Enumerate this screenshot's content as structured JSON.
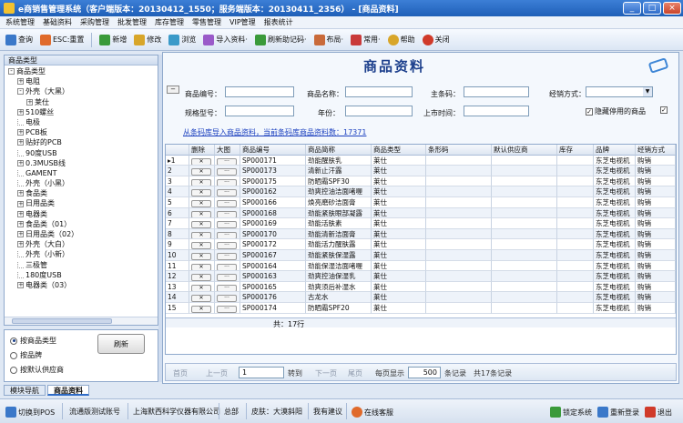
{
  "window": {
    "title": "e商销售管理系统（客户端版本：20130412_1550；服务端版本：20130411_2356） - [商品资料]",
    "minimize": "_",
    "maximize": "□",
    "close": "×"
  },
  "menu": [
    "系统管理",
    "基础资料",
    "采购管理",
    "批发管理",
    "库存管理",
    "零售管理",
    "VIP管理",
    "报表统计"
  ],
  "toolbar": [
    {
      "label": "查询",
      "icon": "search-icon",
      "color": "#3a78c9"
    },
    {
      "label": "ESC:重置",
      "icon": "reset-icon",
      "color": "#e06a2b"
    },
    {
      "label": "新增",
      "icon": "add-icon",
      "color": "#3a9a3a"
    },
    {
      "label": "修改",
      "icon": "edit-icon",
      "color": "#d8a62a"
    },
    {
      "label": "浏览",
      "icon": "browse-icon",
      "color": "#3a9ac9"
    },
    {
      "label": "导入资料·",
      "icon": "import-icon",
      "color": "#9a5ac9"
    },
    {
      "label": "刷新助记码·",
      "icon": "refresh-code-icon",
      "color": "#3a9a3a"
    },
    {
      "label": "布局·",
      "icon": "layout-icon",
      "color": "#c96a3a"
    },
    {
      "label": "常用·",
      "icon": "favorite-icon",
      "color": "#c93a3a"
    },
    {
      "label": "帮助",
      "icon": "help-icon",
      "color": "#d8a62a"
    },
    {
      "label": "关闭",
      "icon": "close-icon",
      "color": "#d03a2a"
    }
  ],
  "left_panel": {
    "header": "商品类型",
    "tree": [
      {
        "label": "商品类型",
        "level": 0,
        "expander": "-"
      },
      {
        "label": "电阻",
        "level": 1,
        "expander": "+"
      },
      {
        "label": "外壳（大黑）",
        "level": 1,
        "expander": "-"
      },
      {
        "label": "莱仕",
        "level": 2,
        "expander": "+"
      },
      {
        "label": "510螺丝",
        "level": 1,
        "expander": "+"
      },
      {
        "label": "电极",
        "level": 1,
        "expander": ""
      },
      {
        "label": "PCB板",
        "level": 1,
        "expander": "+"
      },
      {
        "label": "贴好的PCB",
        "level": 1,
        "expander": "+"
      },
      {
        "label": "90度USB",
        "level": 1,
        "expander": ""
      },
      {
        "label": "0.3MUSB线",
        "level": 1,
        "expander": "+"
      },
      {
        "label": "GAMENT",
        "level": 1,
        "expander": ""
      },
      {
        "label": "外壳（小黑）",
        "level": 1,
        "expander": ""
      },
      {
        "label": "食品类",
        "level": 1,
        "expander": "+"
      },
      {
        "label": "日用品类",
        "level": 1,
        "expander": "+"
      },
      {
        "label": "电器类",
        "level": 1,
        "expander": "+"
      },
      {
        "label": "食品类（01）",
        "level": 1,
        "expander": "+"
      },
      {
        "label": "日用品类（02）",
        "level": 1,
        "expander": "+"
      },
      {
        "label": "外壳（大白）",
        "level": 1,
        "expander": "+"
      },
      {
        "label": "外壳（小新）",
        "level": 1,
        "expander": ""
      },
      {
        "label": "三极管",
        "level": 1,
        "expander": ""
      },
      {
        "label": "180度USB",
        "level": 1,
        "expander": ""
      },
      {
        "label": "电器类（03）",
        "level": 1,
        "expander": "+"
      }
    ],
    "radios": [
      {
        "label": "按商品类型",
        "checked": true
      },
      {
        "label": "按品牌",
        "checked": false
      },
      {
        "label": "按默认供应商",
        "checked": false
      }
    ],
    "refresh_button": "刷新"
  },
  "main": {
    "title": "商品资料",
    "collapse": "−",
    "filters": {
      "code_label": "商品编号：",
      "name_label": "商品名称：",
      "barcode_label": "主条码：",
      "manage_label": "经销方式：",
      "spec_label": "规格型号：",
      "year_label": "年份：",
      "market_label": "上市时间：",
      "hide_disabled": "隐藏停用的商品",
      "hide_disabled_checked": "✓",
      "extra_check": "",
      "extra_checked": "✓"
    },
    "import_link": "从条码库导入商品资料，当前条码库商品资料数：17371",
    "columns": [
      "",
      "删除",
      "大图",
      "商品编号",
      "商品简称",
      "商品类型",
      "条形码",
      "默认供应商",
      "库存",
      "品牌",
      "经销方式"
    ],
    "delete_btn": "✕",
    "image_btn": "···",
    "rows": [
      {
        "no": "▸1",
        "code": "SP000171",
        "name": "劲能醒肤乳",
        "type": "莱仕",
        "barcode": "",
        "supplier": "",
        "stock": "",
        "brand": "东芝电视机",
        "mode": "购销"
      },
      {
        "no": "2",
        "code": "SP000173",
        "name": "清新止汗露",
        "type": "莱仕",
        "barcode": "",
        "supplier": "",
        "stock": "",
        "brand": "东芝电视机",
        "mode": "购销"
      },
      {
        "no": "3",
        "code": "SP000175",
        "name": "防晒霜SPF30",
        "type": "莱仕",
        "barcode": "",
        "supplier": "",
        "stock": "",
        "brand": "东芝电视机",
        "mode": "购销"
      },
      {
        "no": "4",
        "code": "SP000162",
        "name": "劲爽控油洁面啫喱",
        "type": "莱仕",
        "barcode": "",
        "supplier": "",
        "stock": "",
        "brand": "东芝电视机",
        "mode": "购销"
      },
      {
        "no": "5",
        "code": "SP000166",
        "name": "焕亮磨砂洁面膏",
        "type": "莱仕",
        "barcode": "",
        "supplier": "",
        "stock": "",
        "brand": "东芝电视机",
        "mode": "购销"
      },
      {
        "no": "6",
        "code": "SP000168",
        "name": "劲能紧肤眼部凝露",
        "type": "莱仕",
        "barcode": "",
        "supplier": "",
        "stock": "",
        "brand": "东芝电视机",
        "mode": "购销"
      },
      {
        "no": "7",
        "code": "SP000169",
        "name": "劲能活肤素",
        "type": "莱仕",
        "barcode": "",
        "supplier": "",
        "stock": "",
        "brand": "东芝电视机",
        "mode": "购销"
      },
      {
        "no": "8",
        "code": "SP000170",
        "name": "劲能清新洁面膏",
        "type": "莱仕",
        "barcode": "",
        "supplier": "",
        "stock": "",
        "brand": "东芝电视机",
        "mode": "购销"
      },
      {
        "no": "9",
        "code": "SP000172",
        "name": "劲能活力醒肤露",
        "type": "莱仕",
        "barcode": "",
        "supplier": "",
        "stock": "",
        "brand": "东芝电视机",
        "mode": "购销"
      },
      {
        "no": "10",
        "code": "SP000167",
        "name": "劲能紧肤保湿露",
        "type": "莱仕",
        "barcode": "",
        "supplier": "",
        "stock": "",
        "brand": "东芝电视机",
        "mode": "购销"
      },
      {
        "no": "11",
        "code": "SP000164",
        "name": "劲能保湿洁面啫喱",
        "type": "莱仕",
        "barcode": "",
        "supplier": "",
        "stock": "",
        "brand": "东芝电视机",
        "mode": "购销"
      },
      {
        "no": "12",
        "code": "SP000163",
        "name": "劲爽控油保湿乳",
        "type": "莱仕",
        "barcode": "",
        "supplier": "",
        "stock": "",
        "brand": "东芝电视机",
        "mode": "购销"
      },
      {
        "no": "13",
        "code": "SP000165",
        "name": "劲爽须后补湿水",
        "type": "莱仕",
        "barcode": "",
        "supplier": "",
        "stock": "",
        "brand": "东芝电视机",
        "mode": "购销"
      },
      {
        "no": "14",
        "code": "SP000176",
        "name": "古龙水",
        "type": "莱仕",
        "barcode": "",
        "supplier": "",
        "stock": "",
        "brand": "东芝电视机",
        "mode": "购销"
      },
      {
        "no": "15",
        "code": "SP000174",
        "name": "防晒霜SPF20",
        "type": "莱仕",
        "barcode": "",
        "supplier": "",
        "stock": "",
        "brand": "东芝电视机",
        "mode": "购销"
      }
    ],
    "footer_total": "共：17行",
    "pager": {
      "first": "首页",
      "prev": "上一页",
      "page": "1",
      "goto": "转到",
      "next": "下一页",
      "last": "尾页",
      "per_page_label": "每页显示",
      "per_page": "500",
      "per_page_unit": "条记录",
      "total": "共17条记录"
    }
  },
  "bottom_tabs": [
    "模块导航",
    "商品资料"
  ],
  "statusbar": {
    "switch_pos": "切换到POS",
    "company": "流通版测试账号",
    "org": "上海默西科学仪器有限公司",
    "dept": "总部",
    "skin": "皮肤：大漠斜阳",
    "suggest": "我有建议",
    "online_service": "在线客服",
    "lock": "锁定系统",
    "relogin": "重新登录",
    "exit": "退出"
  }
}
